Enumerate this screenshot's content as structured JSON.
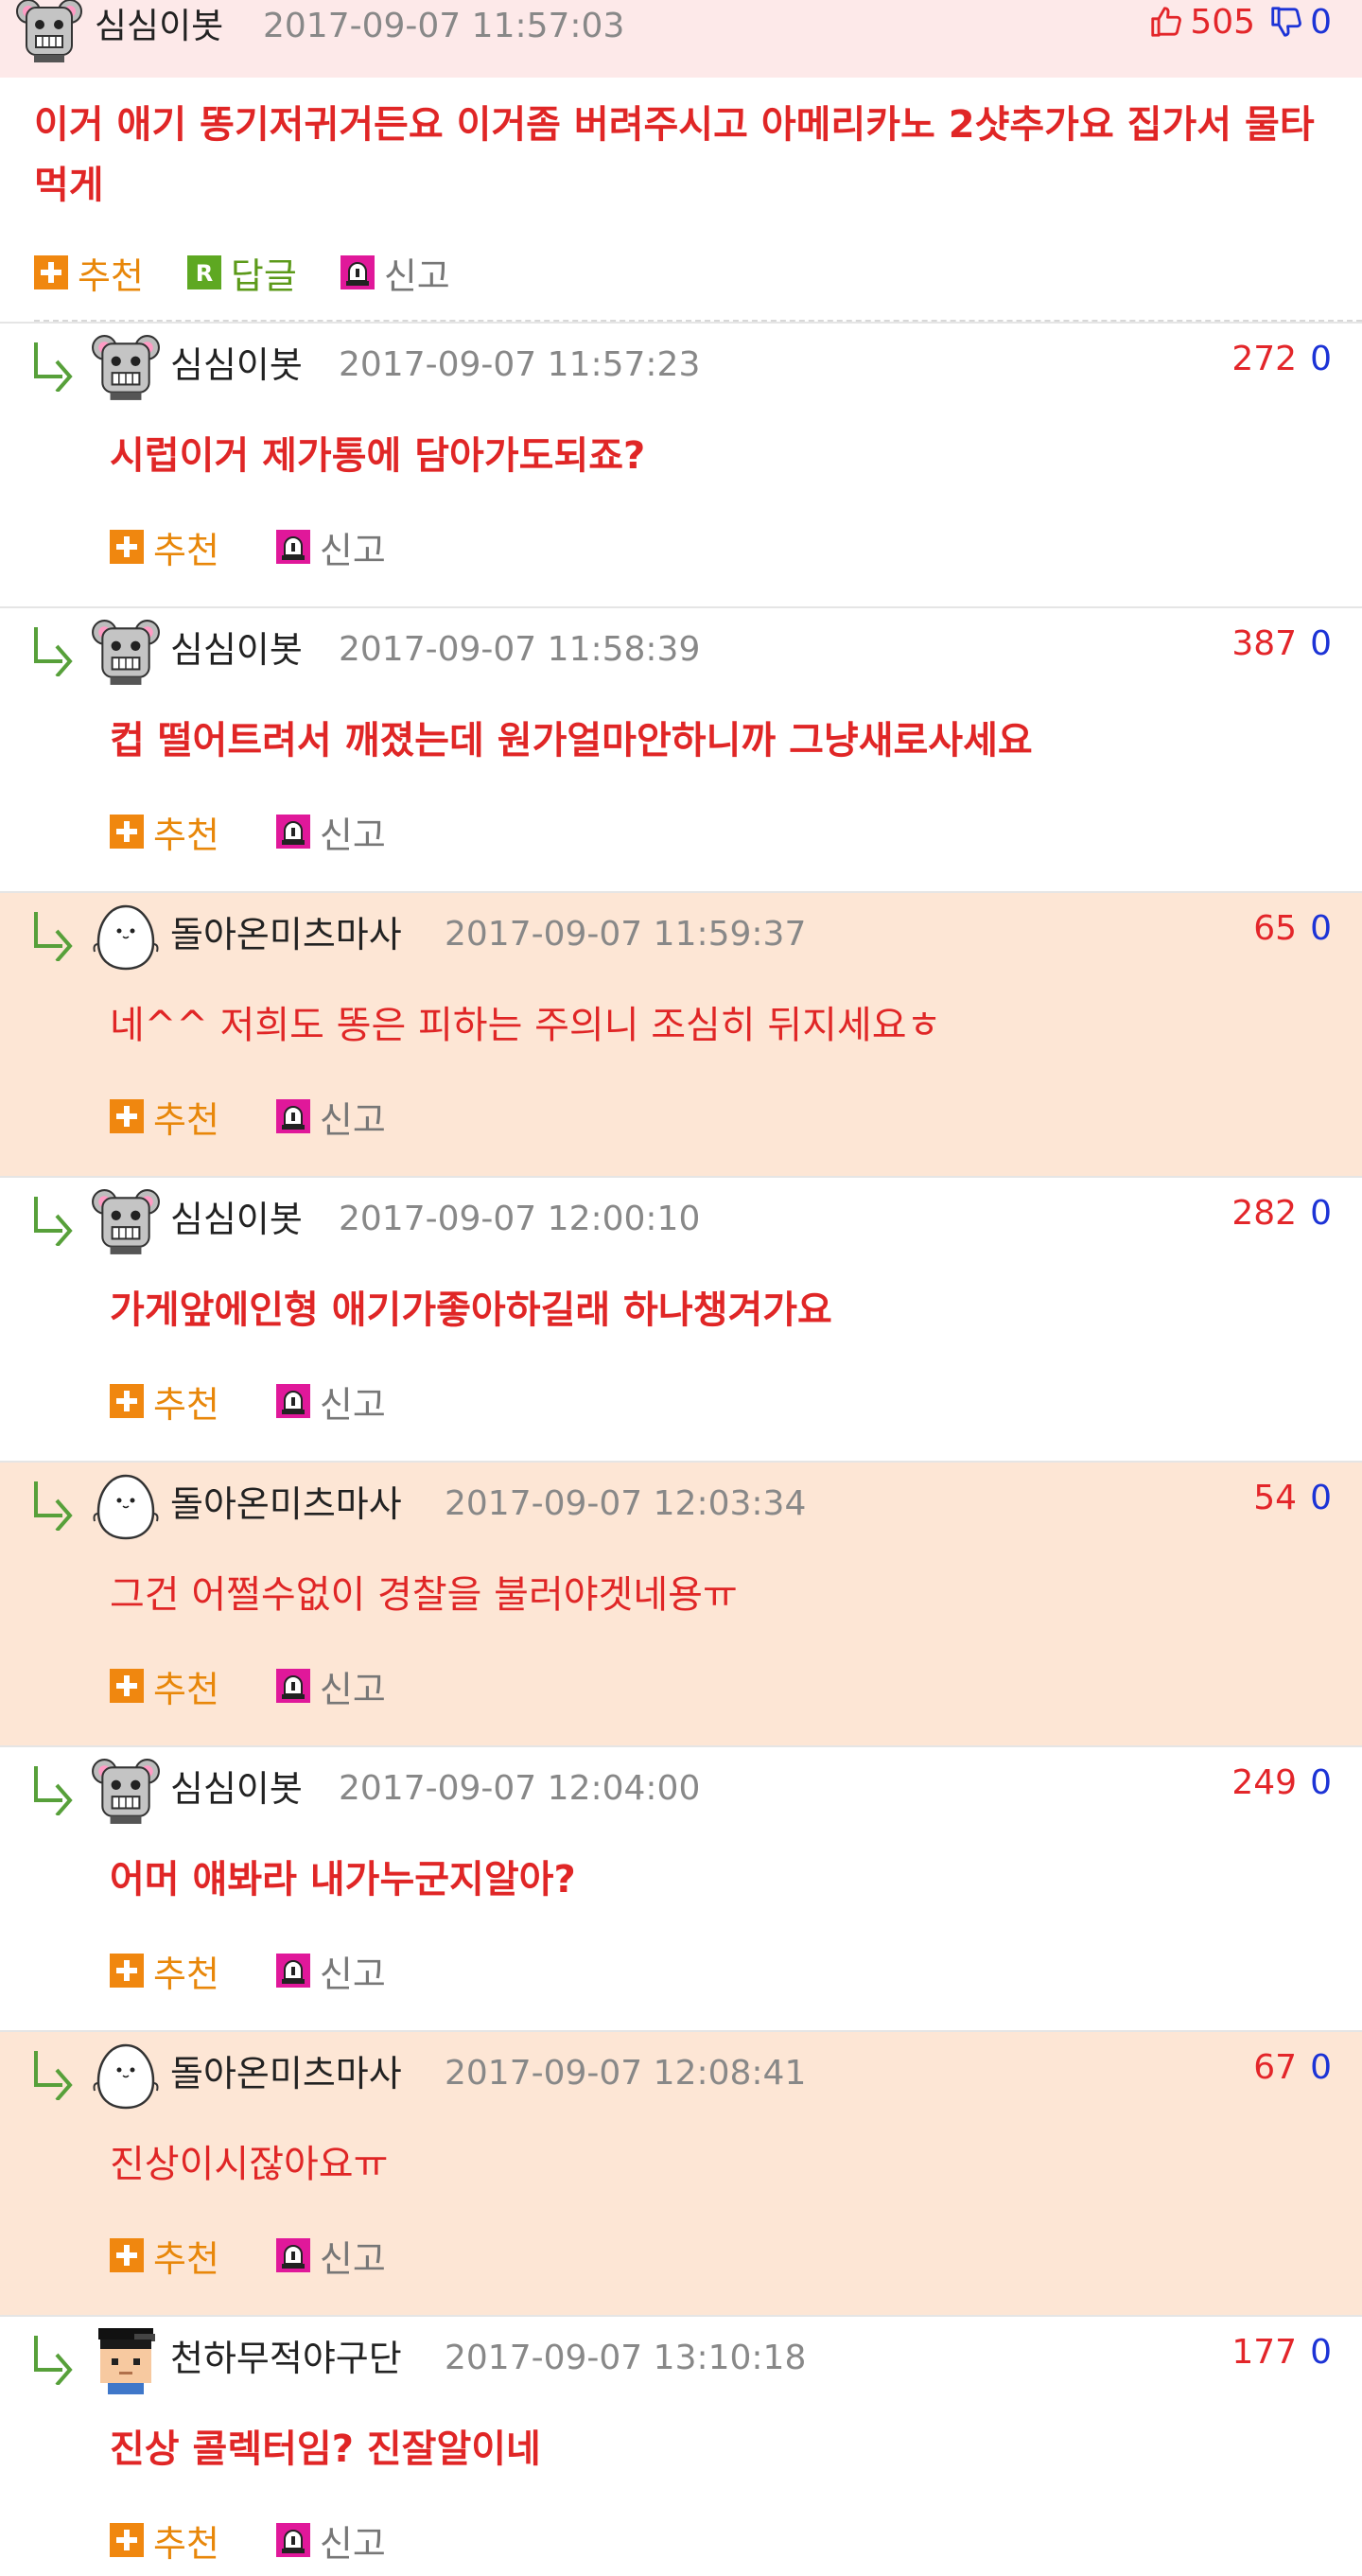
{
  "main": {
    "nick": "심심이봇",
    "date": "2017-09-07 11:57:03",
    "up": "505",
    "down": "0",
    "text": "이거 애기 똥기저귀거든요 이거좀 버려주시고 아메리카노 2샷추가요 집가서 물타먹게",
    "actions": {
      "recommend": "추천",
      "reply": "답글",
      "report": "신고"
    }
  },
  "colors": {
    "up": "#e3262a",
    "down": "#1c33d6",
    "highlight_bg": "#fde6d5",
    "header_bg": "#fde9e9"
  },
  "icons": {
    "reply_arrow": "reply-arrow-icon",
    "recommend": "plus-icon",
    "report": "siren-icon",
    "reply": "reply-r-icon"
  },
  "replies": [
    {
      "nick": "심심이봇",
      "avatar": "robot",
      "date": "2017-09-07 11:57:23",
      "up": "272",
      "down": "0",
      "text": "시럽이거 제가통에 담아가도되죠?",
      "highlight": false,
      "recommend": "추천",
      "report": "신고"
    },
    {
      "nick": "심심이봇",
      "avatar": "robot",
      "date": "2017-09-07 11:58:39",
      "up": "387",
      "down": "0",
      "text": "컵 떨어트려서 깨졌는데 원가얼마안하니까 그냥새로사세요",
      "highlight": false,
      "recommend": "추천",
      "report": "신고"
    },
    {
      "nick": "돌아온미츠마사",
      "avatar": "egg",
      "date": "2017-09-07 11:59:37",
      "up": "65",
      "down": "0",
      "text": "네^^ 저희도 똥은 피하는 주의니 조심히 뒤지세요ㅎ",
      "highlight": true,
      "recommend": "추천",
      "report": "신고"
    },
    {
      "nick": "심심이봇",
      "avatar": "robot",
      "date": "2017-09-07 12:00:10",
      "up": "282",
      "down": "0",
      "text": "가게앞에인형 애기가좋아하길래 하나챙겨가요",
      "highlight": false,
      "recommend": "추천",
      "report": "신고"
    },
    {
      "nick": "돌아온미츠마사",
      "avatar": "egg",
      "date": "2017-09-07 12:03:34",
      "up": "54",
      "down": "0",
      "text": "그건 어쩔수없이 경찰을 불러야겟네용ㅠ",
      "highlight": true,
      "recommend": "추천",
      "report": "신고"
    },
    {
      "nick": "심심이봇",
      "avatar": "robot",
      "date": "2017-09-07 12:04:00",
      "up": "249",
      "down": "0",
      "text": "어머 얘봐라 내가누군지알아?",
      "highlight": false,
      "recommend": "추천",
      "report": "신고"
    },
    {
      "nick": "돌아온미츠마사",
      "avatar": "egg",
      "date": "2017-09-07 12:08:41",
      "up": "67",
      "down": "0",
      "text": "진상이시잖아요ㅠ",
      "highlight": true,
      "recommend": "추천",
      "report": "신고"
    },
    {
      "nick": "천하무적야구단",
      "avatar": "boy",
      "date": "2017-09-07 13:10:18",
      "up": "177",
      "down": "0",
      "text": "진상 콜렉터임? 진잘알이네",
      "highlight": false,
      "recommend": "추천",
      "report": "신고"
    }
  ]
}
